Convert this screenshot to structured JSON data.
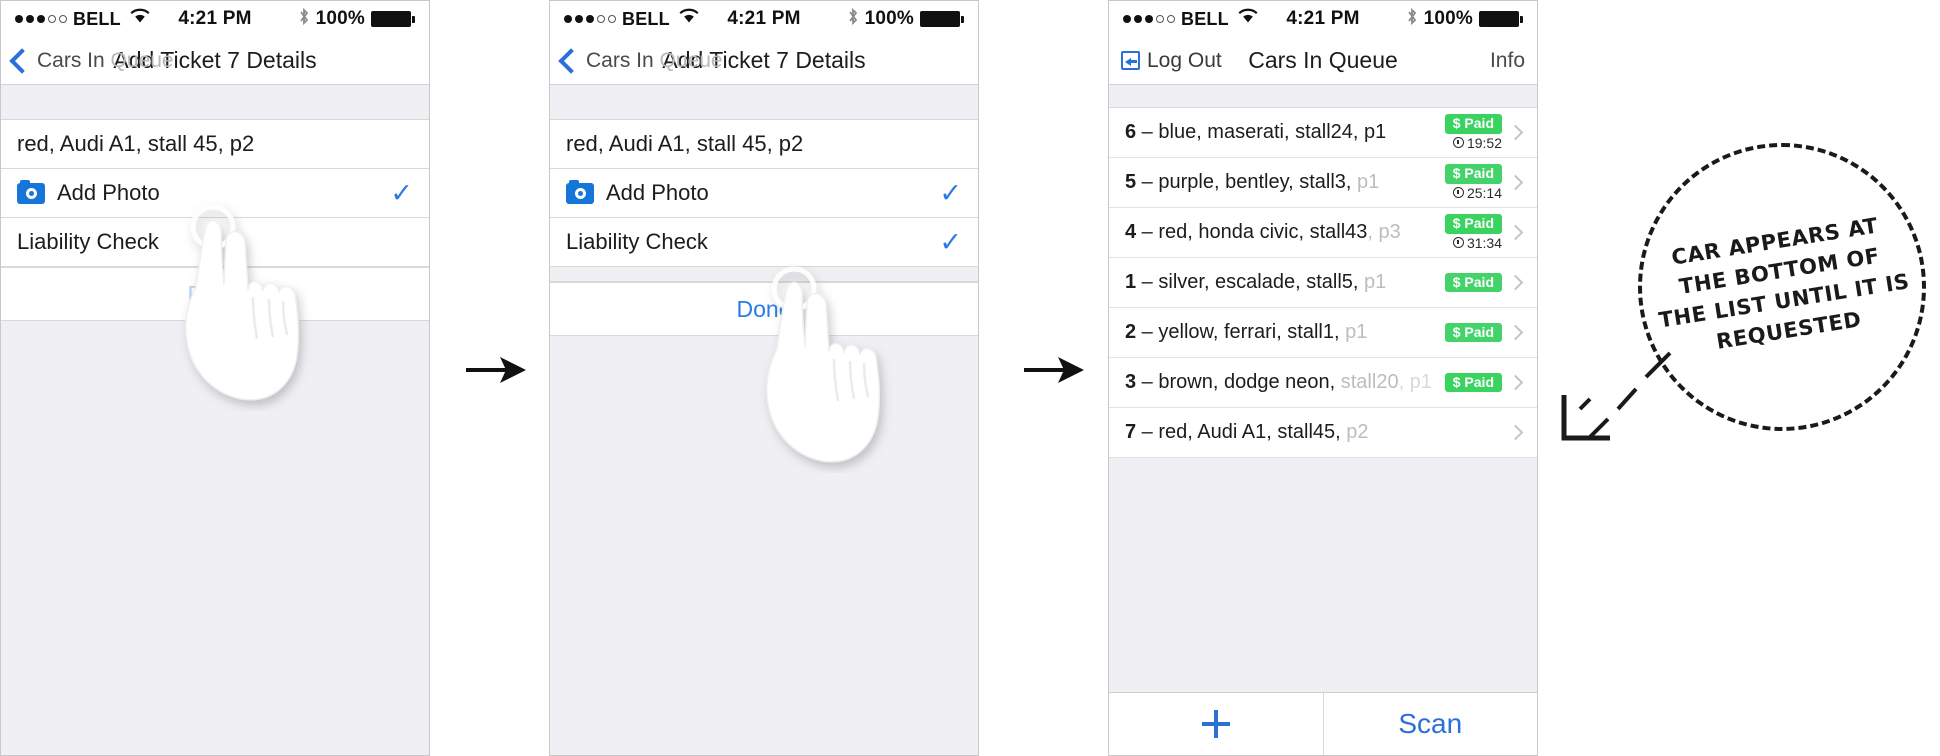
{
  "status_bar": {
    "carrier": "BELL",
    "signal_filled": 3,
    "signal_hollow": 2,
    "wifi_icon": "wifi-icon",
    "time": "4:21 PM",
    "bluetooth_icon": "bluetooth-icon",
    "battery_percent": "100%"
  },
  "phone1": {
    "nav": {
      "back_icon": "chevron-left-icon",
      "back_label": "Cars In",
      "back_label_faded": "Queue",
      "title": "Add Ticket 7 Details"
    },
    "cells": [
      {
        "label": "red, Audi A1, stall 45, p2",
        "icon": null,
        "checked": false
      },
      {
        "label": "Add Photo",
        "icon": "camera-icon",
        "checked": true
      },
      {
        "label": "Liability Check",
        "icon": null,
        "checked": false
      }
    ],
    "done_label": "Done",
    "hand_icon": "tap-hand-icon"
  },
  "phone2": {
    "nav": {
      "back_icon": "chevron-left-icon",
      "back_label": "Cars In",
      "back_label_faded": "Queue",
      "title": "Add Ticket 7 Details"
    },
    "cells": [
      {
        "label": "red, Audi A1, stall 45, p2",
        "icon": null,
        "checked": false
      },
      {
        "label": "Add Photo",
        "icon": "camera-icon",
        "checked": true
      },
      {
        "label": "Liability Check",
        "icon": null,
        "checked": true
      }
    ],
    "done_label": "Done",
    "hand_icon": "tap-hand-icon"
  },
  "phone3": {
    "nav": {
      "logout_icon": "logout-icon",
      "logout_label": "Log Out",
      "title": "Cars In Queue",
      "info_label": "Info"
    },
    "queue": [
      {
        "num": "6",
        "desc": "blue, maserati, stall24, p1",
        "faded": "",
        "faded2": "",
        "badge": "$ Paid",
        "timer": "19:52",
        "chevron": "chevron-right-icon"
      },
      {
        "num": "5",
        "desc": "purple, bentley, stall3, ",
        "faded": "p1",
        "faded2": "",
        "badge": "$ Paid",
        "timer": "25:14",
        "chevron": "chevron-right-icon"
      },
      {
        "num": "4",
        "desc": "red, honda civic, stall43",
        "faded": ", p3",
        "faded2": "",
        "badge": "$ Paid",
        "timer": "31:34",
        "chevron": "chevron-right-icon"
      },
      {
        "num": "1",
        "desc": "silver, escalade, stall5, ",
        "faded": "p1",
        "faded2": "",
        "badge": "$ Paid",
        "timer": "",
        "chevron": "chevron-right-icon"
      },
      {
        "num": "2",
        "desc": "yellow, ferrari, stall1, ",
        "faded": "p1",
        "faded2": "",
        "badge": "$ Paid",
        "timer": "",
        "chevron": "chevron-right-icon"
      },
      {
        "num": "3",
        "desc": "brown, dodge neon, ",
        "faded": "stall20",
        "faded2": ", p1",
        "badge": "$ Paid",
        "timer": "",
        "chevron": "chevron-right-icon"
      },
      {
        "num": "7",
        "desc": "red, Audi A1, stall45, ",
        "faded": "p2",
        "faded2": "",
        "badge": "",
        "timer": "",
        "chevron": "chevron-right-icon"
      }
    ],
    "toolbar": {
      "add_icon": "plus-icon",
      "scan_label": "Scan"
    }
  },
  "flow": {
    "arrow_icon": "arrow-right-icon"
  },
  "callout": {
    "lines": [
      "CAR APPEARS AT",
      "THE BOTTOM OF",
      "THE LIST UNTIL IT IS",
      "REQUESTED"
    ],
    "pointer_icon": "callout-pointer-icon"
  },
  "colors": {
    "accent_blue": "#2c6fd8",
    "paid_green": "#3ad35f",
    "group_bg": "#efeff4"
  }
}
